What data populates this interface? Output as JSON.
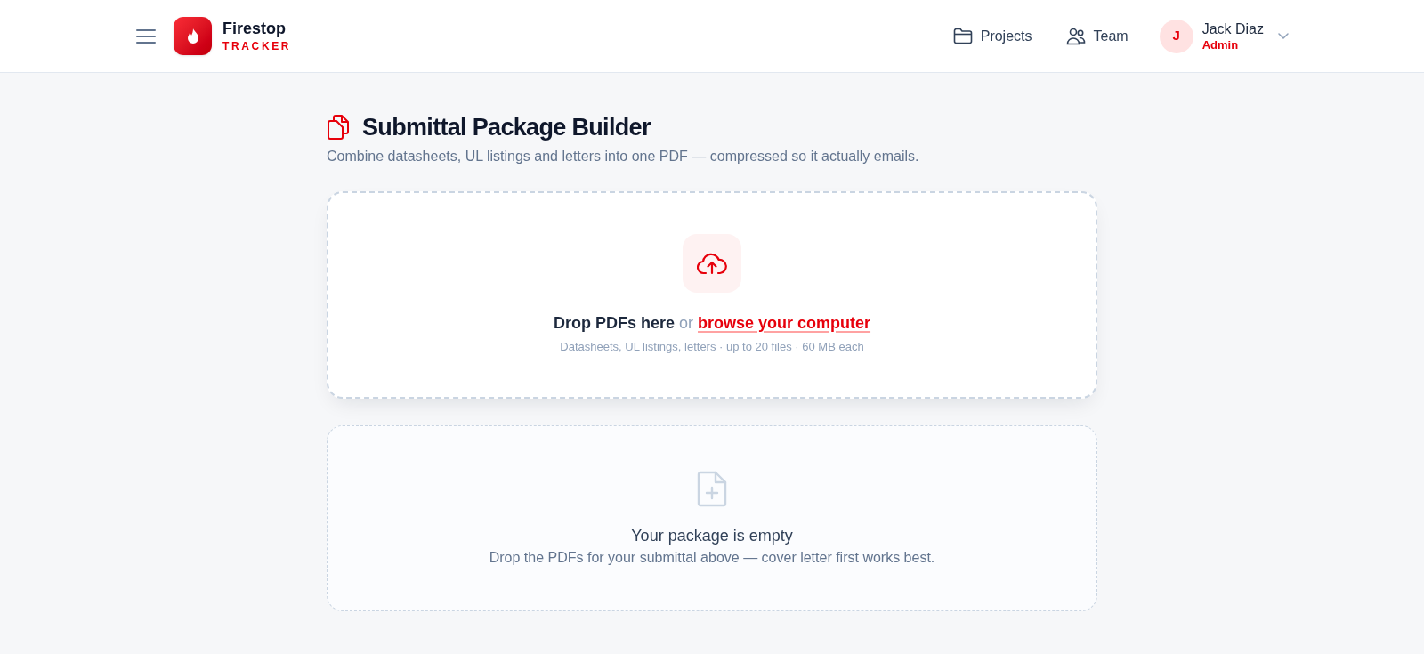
{
  "header": {
    "brand": {
      "name": "Firestop",
      "tagline": "TRACKER"
    },
    "nav": [
      {
        "label": "Projects"
      },
      {
        "label": "Team"
      }
    ],
    "user": {
      "initial": "J",
      "name": "Jack Diaz",
      "role": "Admin"
    }
  },
  "page": {
    "title": "Submittal Package Builder",
    "subtitle": "Combine datasheets, UL listings and letters into one PDF — compressed so it actually emails."
  },
  "dropzone": {
    "prompt": "Drop PDFs here",
    "separator": "or",
    "link": "browse your computer",
    "hint": "Datasheets, UL listings, letters · up to 20 files · 60 MB each"
  },
  "package": {
    "title": "Your package is empty",
    "message": "Drop the PDFs for your submittal above — cover letter first works best."
  }
}
